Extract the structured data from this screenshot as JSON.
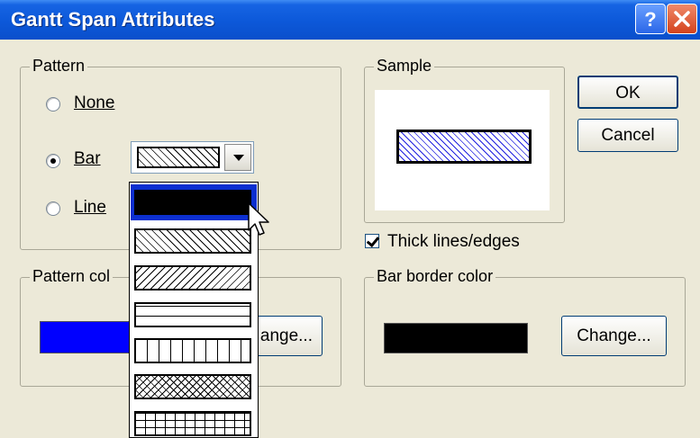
{
  "title": "Gantt Span Attributes",
  "pattern": {
    "group_label": "Pattern",
    "options": [
      {
        "label": "None",
        "selected": false
      },
      {
        "label": "Bar",
        "selected": true
      },
      {
        "label": "Line",
        "selected": false
      }
    ],
    "combo_selected": "diagonal-hatch"
  },
  "dropdown": {
    "items": [
      {
        "pattern": "solid",
        "highlighted": true
      },
      {
        "pattern": "diagonal-hatch",
        "highlighted": false
      },
      {
        "pattern": "diagonal-hatch-reverse",
        "highlighted": false
      },
      {
        "pattern": "horizontal-lines",
        "highlighted": false
      },
      {
        "pattern": "vertical-lines",
        "highlighted": false
      },
      {
        "pattern": "crosshatch",
        "highlighted": false
      },
      {
        "pattern": "grid",
        "highlighted": false
      }
    ]
  },
  "sample": {
    "group_label": "Sample",
    "preview_color": "#2020e0"
  },
  "thick_lines": {
    "label": "Thick lines/edges",
    "checked": true
  },
  "pattern_color": {
    "group_label": "Pattern col",
    "color": "#0000ff",
    "button_label": "ange..."
  },
  "bar_border_color": {
    "group_label": "Bar border color",
    "color": "#000000",
    "button_label": "Change..."
  },
  "buttons": {
    "ok": "OK",
    "cancel": "Cancel"
  },
  "colors": {
    "titlebar": "#0a4fcb",
    "dialog_bg": "#ece9d8",
    "highlight": "#0b2fd0"
  }
}
